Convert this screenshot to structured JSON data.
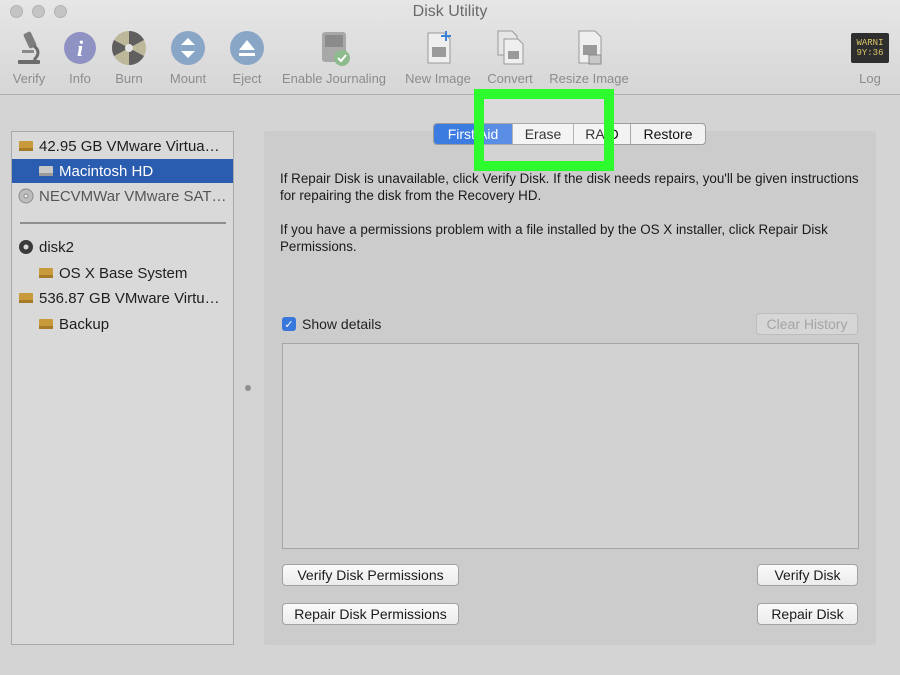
{
  "window": {
    "title": "Disk Utility"
  },
  "toolbar": {
    "items": [
      {
        "label": "Verify",
        "icon": "microscope-icon"
      },
      {
        "label": "Info",
        "icon": "info-icon"
      },
      {
        "label": "Burn",
        "icon": "burn-icon"
      },
      {
        "label": "Mount",
        "icon": "mount-icon"
      },
      {
        "label": "Eject",
        "icon": "eject-icon"
      },
      {
        "label": "Enable Journaling",
        "icon": "journaling-icon"
      },
      {
        "label": "New Image",
        "icon": "new-image-icon"
      },
      {
        "label": "Convert",
        "icon": "convert-icon"
      },
      {
        "label": "Resize Image",
        "icon": "resize-image-icon"
      },
      {
        "label": "Log",
        "icon": "log-icon"
      }
    ],
    "log_icon_text": [
      "WARNI",
      "9Y:36"
    ]
  },
  "sidebar": {
    "items": [
      {
        "label": "42.95 GB VMware Virtua…",
        "icon": "drive-icon"
      },
      {
        "label": "Macintosh HD",
        "icon": "volume-icon",
        "selected": true
      },
      {
        "label": "NECVMWar VMware SAT…",
        "icon": "optical-disc-icon"
      },
      {
        "label": "disk2",
        "icon": "disk-image-icon"
      },
      {
        "label": "OS X Base System",
        "icon": "volume-icon"
      },
      {
        "label": "536.87 GB VMware Virtu…",
        "icon": "drive-icon"
      },
      {
        "label": "Backup",
        "icon": "volume-icon"
      }
    ]
  },
  "tabs": [
    {
      "label": "First Aid",
      "active": true
    },
    {
      "label": "Erase",
      "active": false
    },
    {
      "label": "RAID",
      "active": false
    },
    {
      "label": "Restore",
      "active": false
    }
  ],
  "main": {
    "para1": "If Repair Disk is unavailable, click Verify Disk. If the disk needs repairs, you'll be given instructions for repairing the disk from the Recovery HD.",
    "para2": "If you have a permissions problem with a file installed by the OS X installer, click Repair Disk Permissions.",
    "show_details_label": "Show details",
    "show_details_checked": true,
    "clear_history_label": "Clear History",
    "verify_permissions_label": "Verify Disk Permissions",
    "repair_permissions_label": "Repair Disk Permissions",
    "verify_disk_label": "Verify Disk",
    "repair_disk_label": "Repair Disk"
  },
  "colors": {
    "selection": "#2a5db0",
    "active_tab": "#3c7be0",
    "highlight": "#2dfb2d"
  }
}
